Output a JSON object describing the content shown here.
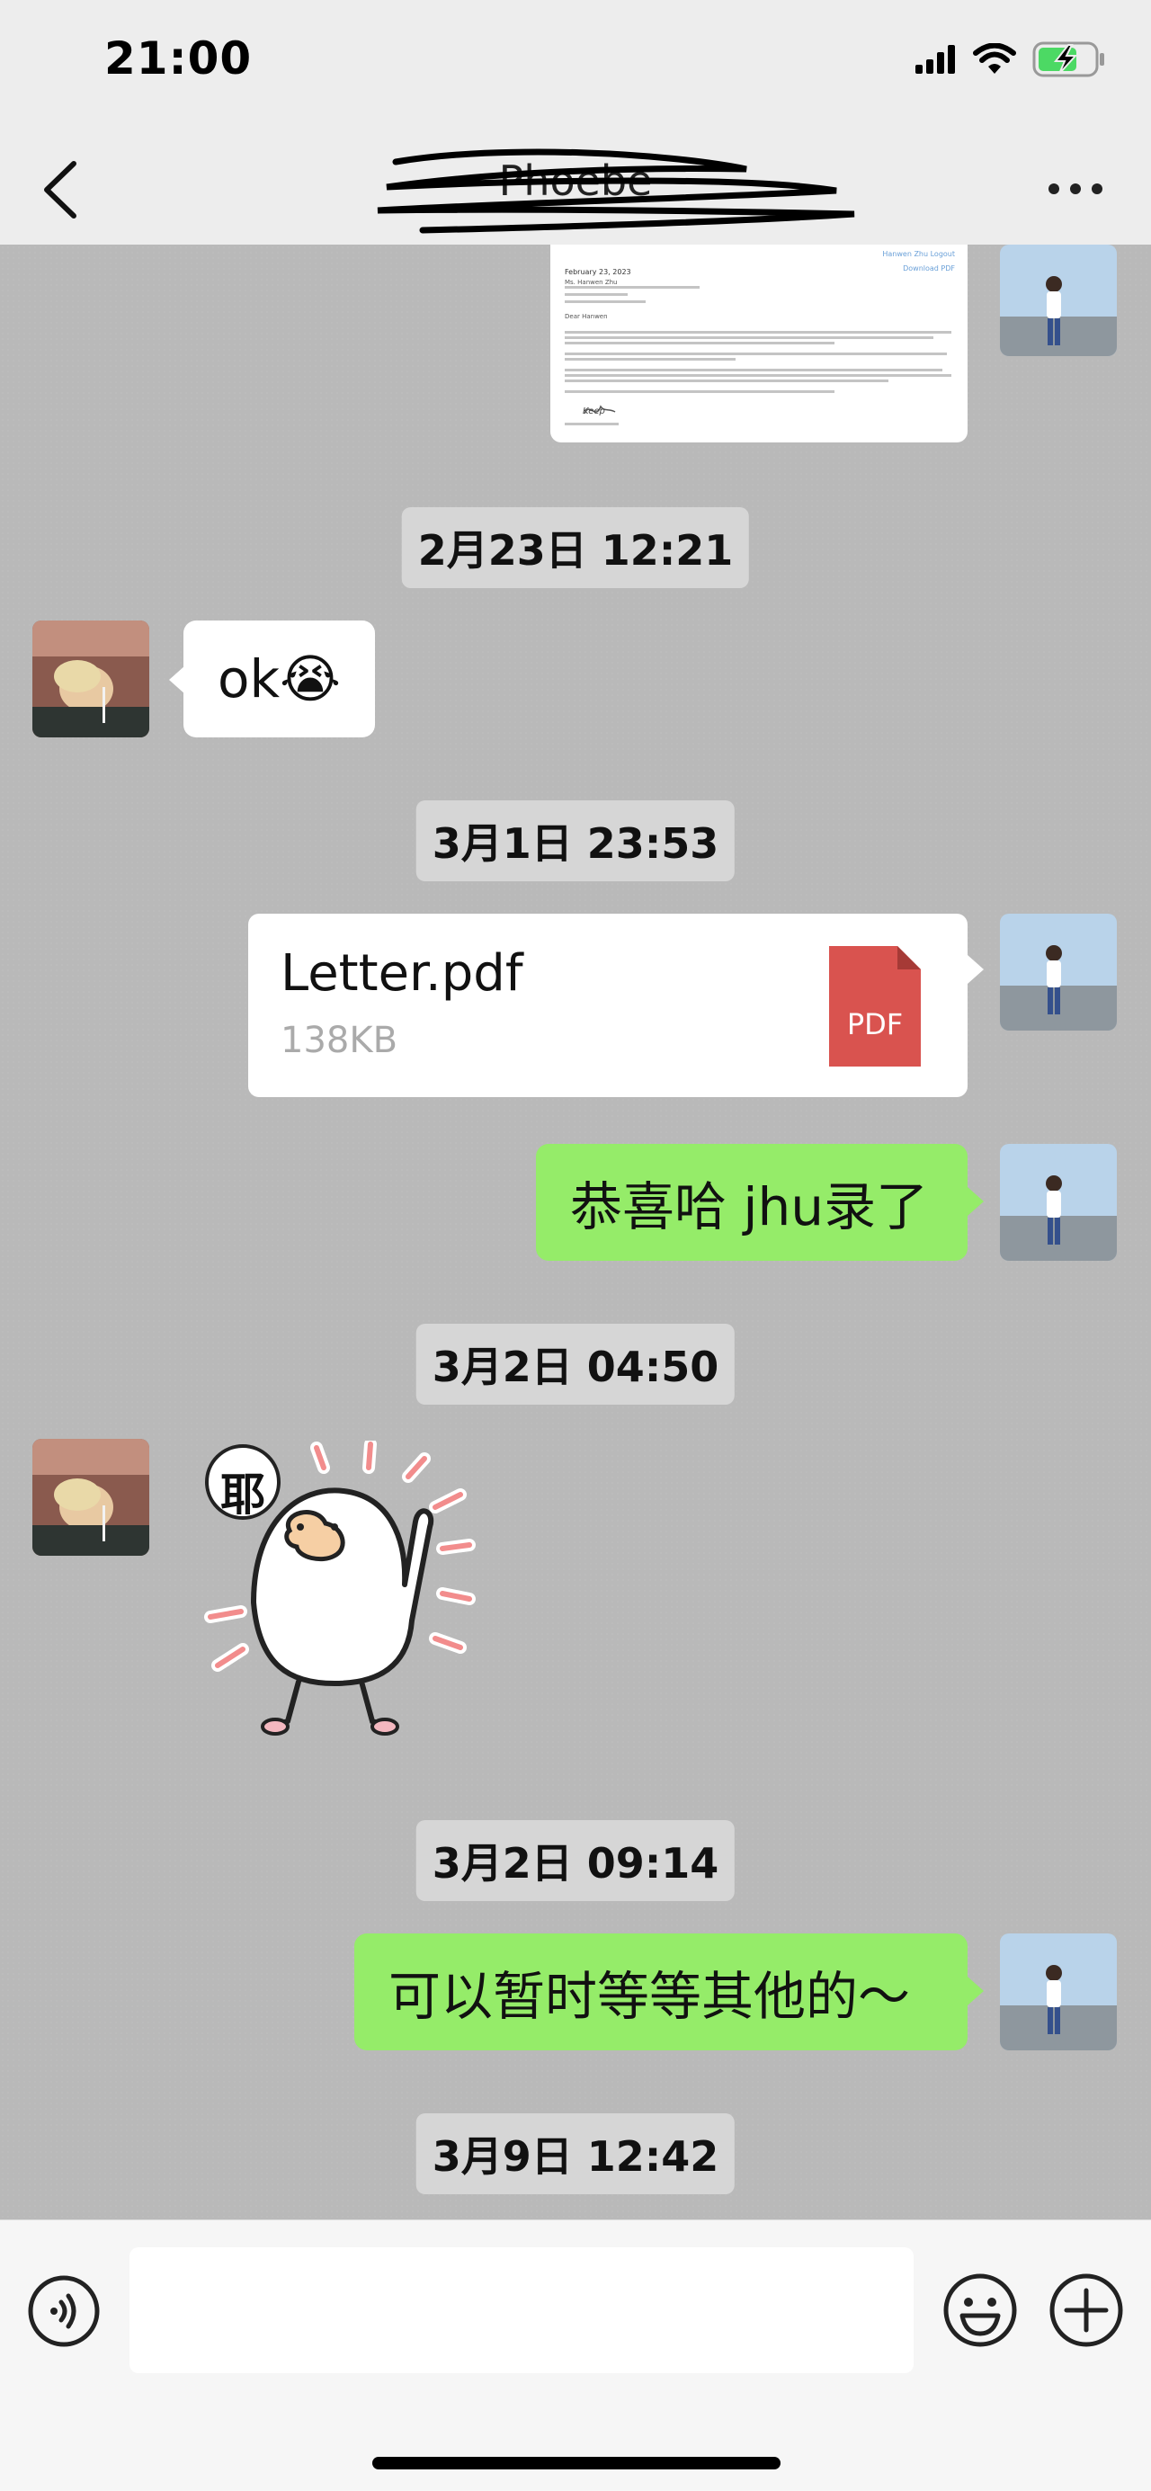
{
  "status_bar": {
    "time": "21:00"
  },
  "header": {
    "title": "Phoebe"
  },
  "messages": [
    {
      "type": "document_preview",
      "sender": "me",
      "lines": [
        "Hanwen Zhu  Logout",
        "Download PDF",
        "February 23, 2023",
        "Ms. Hanwen Zhu",
        "Dear Hanwen",
        "Keep"
      ]
    },
    {
      "type": "timestamp",
      "text": "2月23日 12:21"
    },
    {
      "type": "text",
      "sender": "her",
      "text": "ok😭"
    },
    {
      "type": "timestamp",
      "text": "3月1日 23:53"
    },
    {
      "type": "file",
      "sender": "me",
      "file_name": "Letter.pdf",
      "file_size": "138KB",
      "file_icon_label": "PDF"
    },
    {
      "type": "text",
      "sender": "me",
      "text": "恭喜哈 jhu录了"
    },
    {
      "type": "timestamp",
      "text": "3月2日 04:50"
    },
    {
      "type": "sticker",
      "sender": "her",
      "sticker_text": "耶"
    },
    {
      "type": "timestamp",
      "text": "3月2日 09:14"
    },
    {
      "type": "text",
      "sender": "me",
      "text": "可以暂时等等其他的～"
    },
    {
      "type": "timestamp",
      "text": "3月9日 12:42"
    }
  ],
  "colors": {
    "green_bubble": "#95ec69",
    "white_bubble": "#ffffff",
    "pdf_red": "#d9534f",
    "chat_bg": "#b9b9b9"
  },
  "icons": [
    "back-icon",
    "more-icon",
    "signal-icon",
    "wifi-icon",
    "battery-icon",
    "voice-icon",
    "emoji-icon",
    "plus-icon",
    "pdf-icon"
  ]
}
